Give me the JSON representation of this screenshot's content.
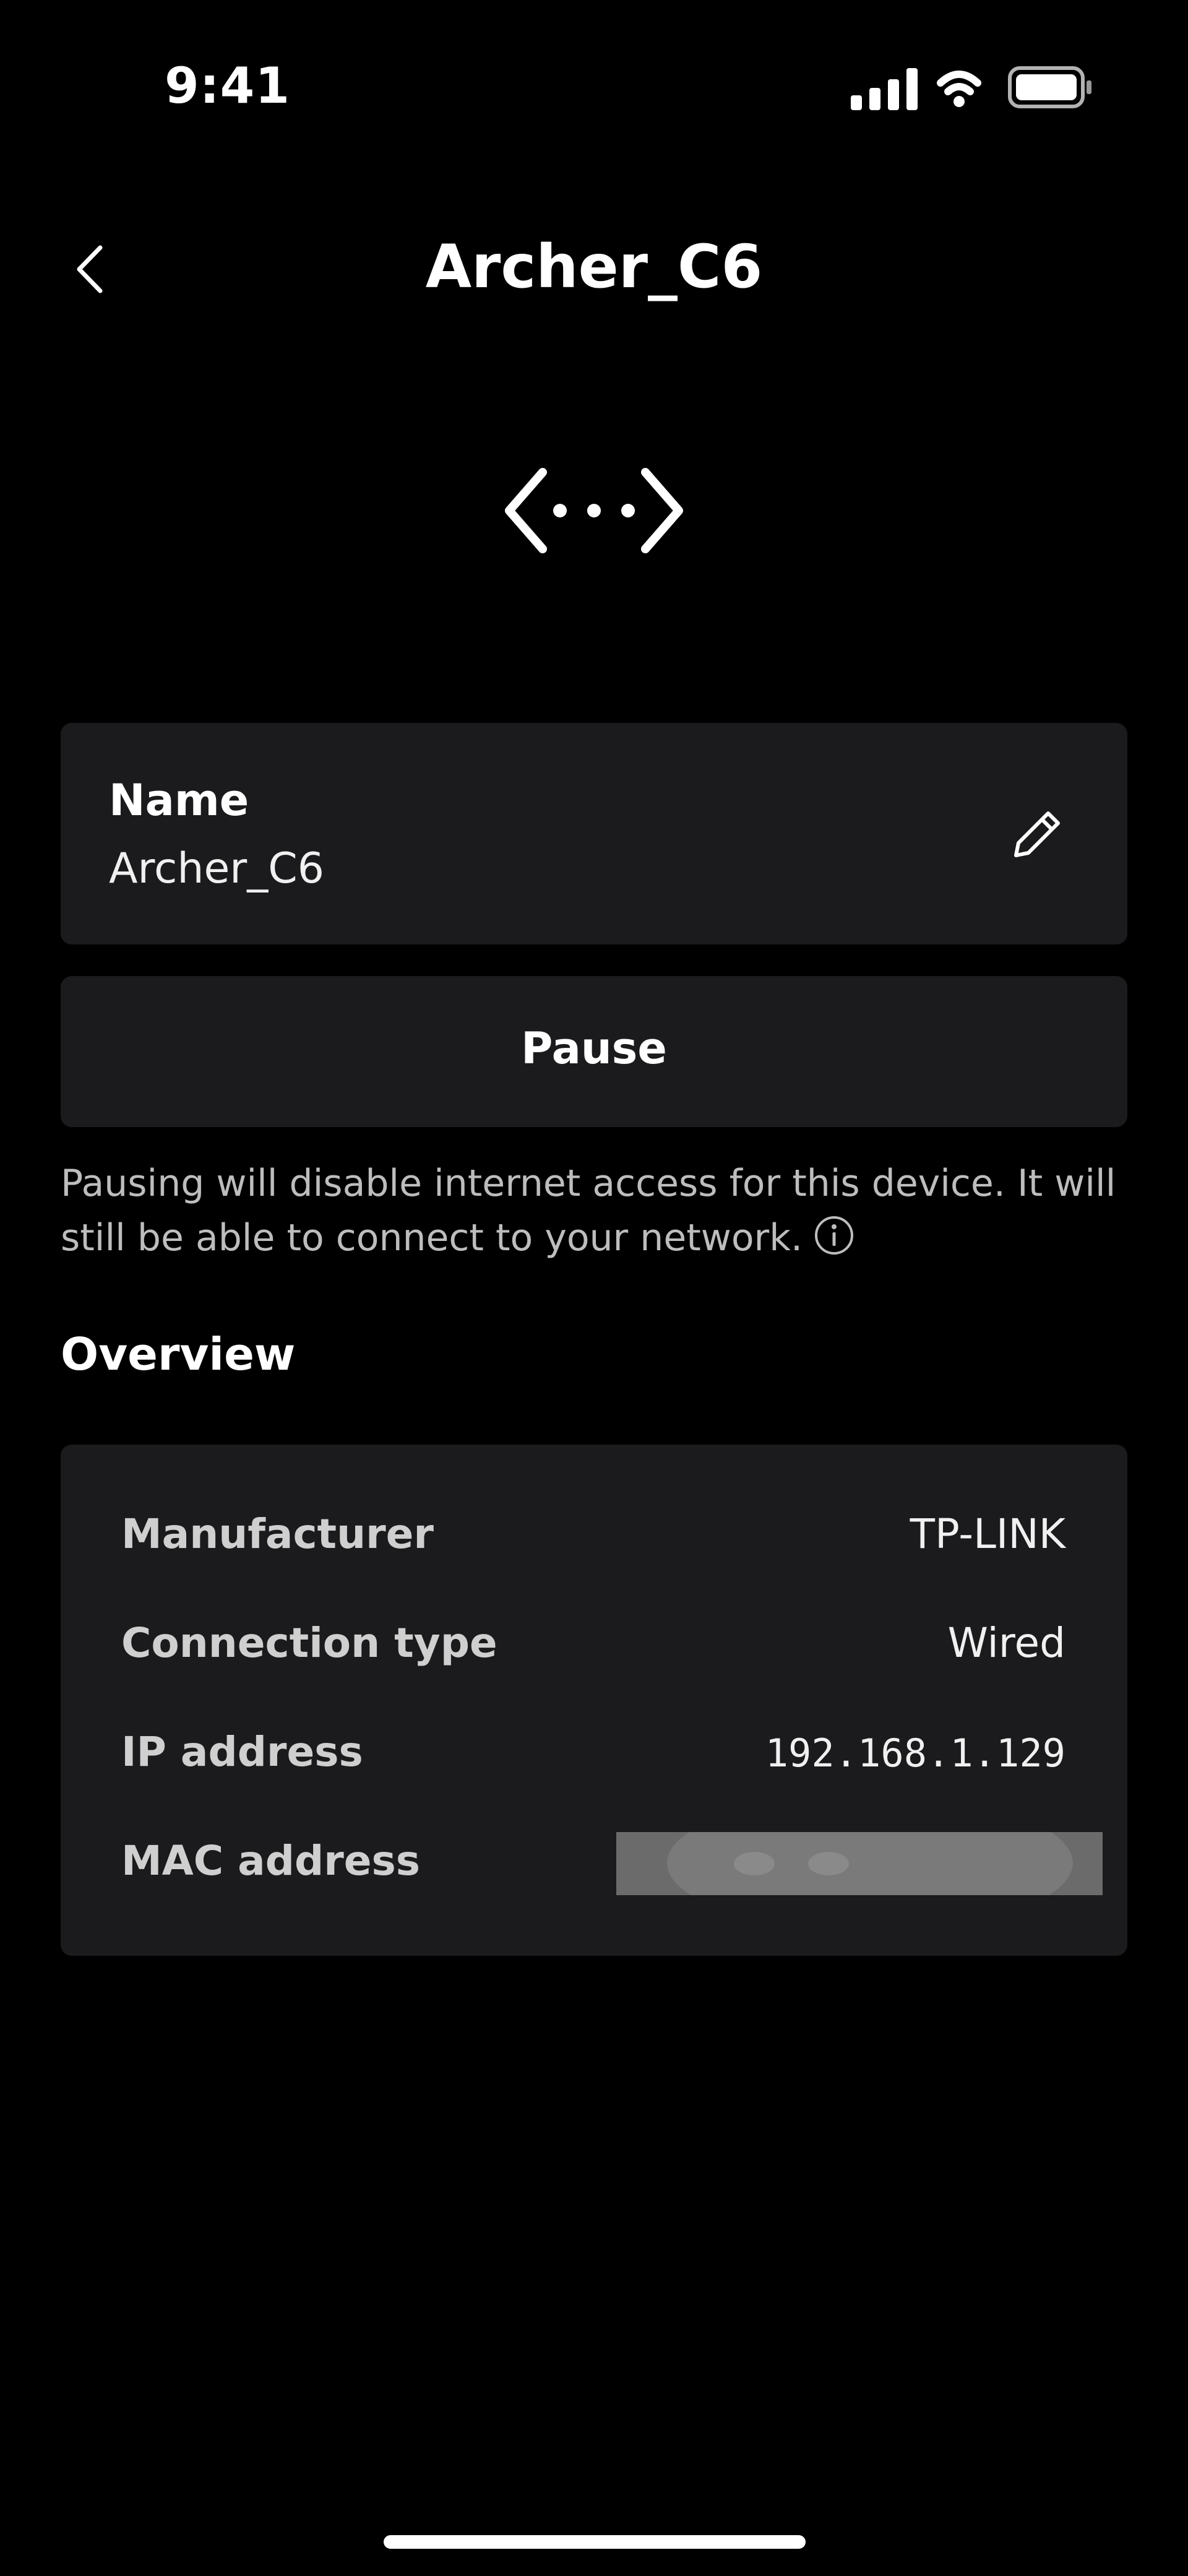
{
  "status_bar": {
    "time": "9:41",
    "icons": [
      "cellular-signal-icon",
      "wifi-icon",
      "battery-icon"
    ]
  },
  "header": {
    "title": "Archer_C6",
    "back_icon": "chevron-left-icon"
  },
  "device_icon": "code-brackets-icon",
  "name_card": {
    "label": "Name",
    "value": "Archer_C6",
    "edit_icon": "pencil-icon"
  },
  "pause": {
    "label": "Pause",
    "description": "Pausing will disable internet access for this device. It will still be able to connect to your network.",
    "info_icon": "info-icon"
  },
  "overview": {
    "title": "Overview",
    "rows": [
      {
        "label": "Manufacturer",
        "value": "TP-LINK"
      },
      {
        "label": "Connection type",
        "value": "Wired"
      },
      {
        "label": "IP address",
        "value": "192.168.1.129"
      },
      {
        "label": "MAC address",
        "value": ""
      }
    ]
  },
  "colors": {
    "background": "#000000",
    "card": "#1b1b1d",
    "text_primary": "#ffffff",
    "text_secondary": "#bdbdbd"
  }
}
